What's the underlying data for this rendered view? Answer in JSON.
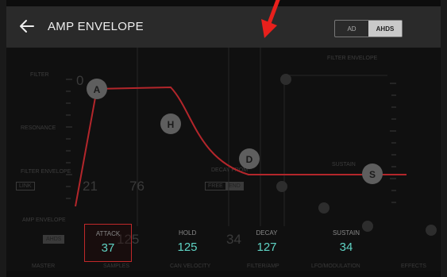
{
  "header": {
    "title": "AMP ENVELOPE",
    "mode_toggle": {
      "options": [
        "AD",
        "AHDS"
      ],
      "selected": "AHDS"
    }
  },
  "envelope_points": [
    {
      "letter": "A",
      "name": "attack"
    },
    {
      "letter": "H",
      "name": "hold"
    },
    {
      "letter": "D",
      "name": "decay"
    },
    {
      "letter": "S",
      "name": "sustain"
    }
  ],
  "params": [
    {
      "label": "ATTACK",
      "value": "37",
      "selected": true
    },
    {
      "label": "HOLD",
      "value": "125",
      "selected": false
    },
    {
      "label": "DECAY",
      "value": "127",
      "selected": false
    },
    {
      "label": "SUSTAIN",
      "value": "34",
      "selected": false
    }
  ],
  "background_ghost": {
    "labels": [
      "FILTER",
      "RESONANCE",
      "FILTER ENVELOPE",
      "AMP ENVELOPE",
      "FILTER ENVELOPE",
      "DECAY FROM",
      "SUSTAIN"
    ],
    "numbers": [
      "0",
      "21",
      "76",
      "125",
      "34"
    ],
    "buttons": [
      "LINK",
      "FREE",
      "END",
      "AHDS"
    ],
    "tabs": [
      "MASTER",
      "SAMPLES",
      "CAN VELOCITY",
      "FILTER/AMP",
      "LFO/MODULATION",
      "EFFECTS"
    ]
  },
  "colors": {
    "curve": "#b3262b",
    "value_text": "#5fd3c4",
    "header_bg": "#2a2a2a",
    "selection": "#c0282a",
    "annotation_arrow": "#e8201c",
    "node_fill": "#5e5e5e"
  }
}
